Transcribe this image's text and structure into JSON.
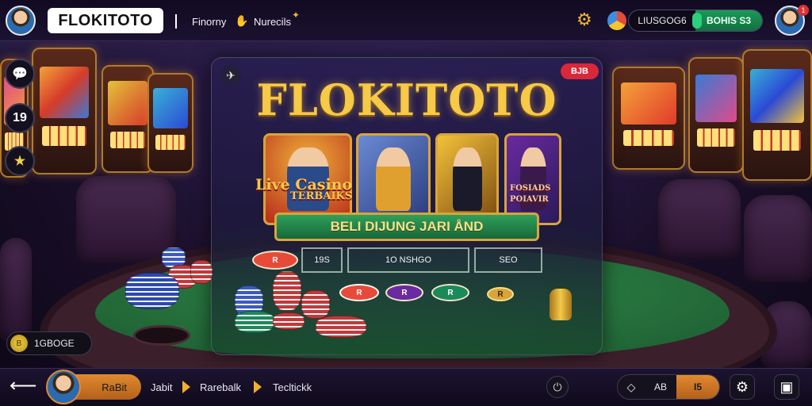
{
  "header": {
    "brand": "FLOKITOTO",
    "links": [
      "Finorny",
      "Nurecils"
    ],
    "balance": "LIUSGOG6",
    "deposit": "BOHIS S3",
    "notification_count": "1"
  },
  "left_rail": {
    "rail_items": [
      "chat",
      "19",
      "star"
    ],
    "coin_balance": "1GBOGE",
    "coin_symbol": "B"
  },
  "game_card": {
    "title": "FLOKITOTO",
    "badge": "BJB",
    "tile_labels": {
      "tile1_line1": "Live Casino",
      "tile1_line2": "TERBAIKS",
      "tile4_line1": "FOSIADS",
      "tile4_line2": "POIAVIR"
    },
    "banner": "BELI DIJUNG JARI ÅND",
    "bet_boxes": [
      "19S",
      "1O NSHGO",
      "SEO"
    ],
    "chip_labels": [
      "R",
      "R",
      "R",
      "R",
      "R"
    ]
  },
  "footer": {
    "user_label": "RaBit",
    "nav": [
      "Jabit",
      "Rarebalk",
      "Tecltickk"
    ],
    "bet_amount": "AB",
    "bet_value": "I5"
  },
  "colors": {
    "gold": "#f6c946",
    "felt": "#2f8a4a",
    "accent_orange": "#e08a30",
    "deposit_green": "#1c9a5a",
    "badge_red": "#d9283a"
  }
}
